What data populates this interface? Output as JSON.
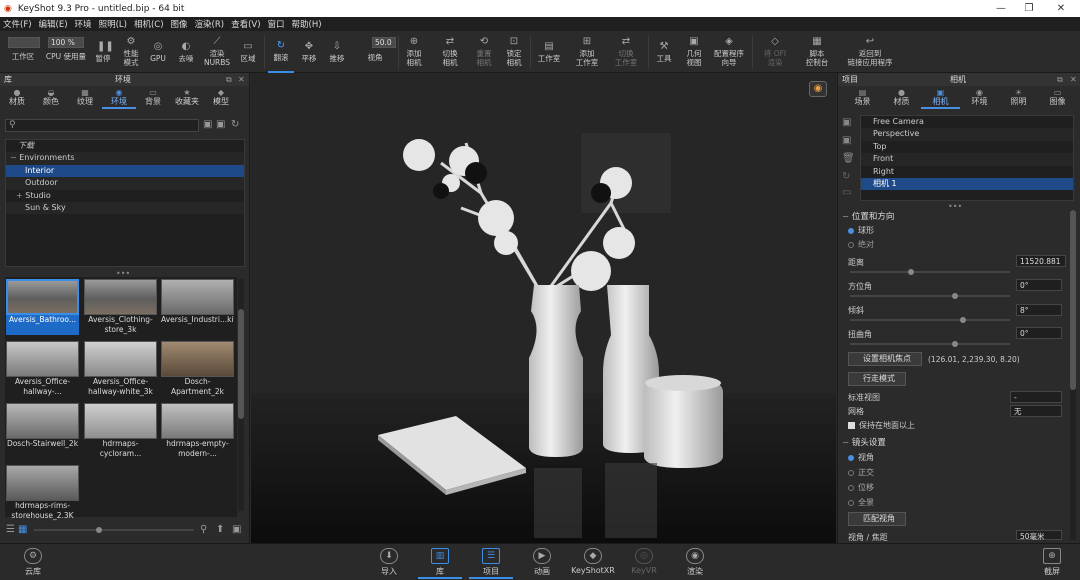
{
  "window": {
    "title": "KeyShot 9.3 Pro  - untitled.bip  - 64 bit",
    "icon": "keyshot-icon"
  },
  "menu": [
    "文件(F)",
    "编辑(E)",
    "环境",
    "照明(L)",
    "相机(C)",
    "图像",
    "渲染(R)",
    "查看(V)",
    "窗口",
    "帮助(H)"
  ],
  "toolbar": {
    "field1": "",
    "cpu_value": "100 %",
    "angle_value": "50.0",
    "items": [
      "工作区",
      "CPU 使用量",
      "暂停",
      "性能\n模式",
      "GPU",
      "去噪",
      "渲染\nNURBS",
      "区域",
      "翻滚",
      "平移",
      "推移",
      "视角",
      "添加\n相机",
      "切换\n相机",
      "重置\n相机",
      "锁定\n相机",
      "工作室",
      "添加\n工作室",
      "切换\n工作室",
      "工具",
      "几何\n视图",
      "配置程序\n向导",
      "将 OFI\n渲染",
      "脚本\n控制台",
      "返回到\n链接应用程序"
    ]
  },
  "left": {
    "header": "库",
    "panel_title": "环境",
    "tabs": [
      "材质",
      "颜色",
      "纹理",
      "环境",
      "背景",
      "收藏夹",
      "模型"
    ],
    "active_tab": "环境",
    "tree": [
      "下载",
      "Environments",
      "Interior",
      "Outdoor",
      "Studio",
      "Sun & Sky"
    ],
    "thumbnails": [
      "Aversis_Bathroo...",
      "Aversis_Clothing-store_3k",
      "Aversis_Industri...kitchen_3k",
      "Aversis_Office-hallway-...",
      "Aversis_Office-hallway-white_3k",
      "Dosch-Apartment_2k",
      "Dosch-Stairwell_2k",
      "hdrmaps-cycloram...",
      "hdrmaps-empty-modern-...",
      "hdrmaps-rims-storehouse_2.3K"
    ]
  },
  "right": {
    "header": "项目",
    "panel_title": "相机",
    "tabs": [
      "场景",
      "材质",
      "相机",
      "环境",
      "照明",
      "图像"
    ],
    "active_tab": "相机",
    "cameras": [
      "Free Camera",
      "Perspective",
      "Top",
      "Front",
      "Right",
      "相机 1"
    ],
    "selected_camera": "相机 1",
    "section_position": "位置和方向",
    "mode_spherical": "球形",
    "mode_absolute": "绝对",
    "distance_label": "距离",
    "distance_value": "11520.881",
    "azimuth_label": "方位角",
    "azimuth_value": "0°",
    "incline_label": "倾斜",
    "incline_value": "8°",
    "twist_label": "扭曲角",
    "twist_value": "0°",
    "set_focus_button": "设置相机焦点",
    "focus_coords": "(126.01, 2,239.30, 8.20)",
    "walk_mode_button": "行走模式",
    "standard_view_label": "标准视图",
    "standard_view_value": "-",
    "grid_label": "网格",
    "grid_value": "无",
    "keep_ground_label": "保持在地面以上",
    "section_lens": "镜头设置",
    "lens_options": [
      "视角",
      "正交",
      "位移",
      "全景"
    ],
    "match_view_button": "匹配视角",
    "fov_label": "视角 / 焦距",
    "fov_value": "50毫米"
  },
  "bottom": {
    "items": [
      "云库",
      "导入",
      "库",
      "项目",
      "动画",
      "KeyShotXR",
      "KeyVR",
      "渲染",
      "截屏"
    ],
    "active": [
      "库",
      "项目"
    ],
    "disabled": [
      "KeyVR"
    ]
  }
}
